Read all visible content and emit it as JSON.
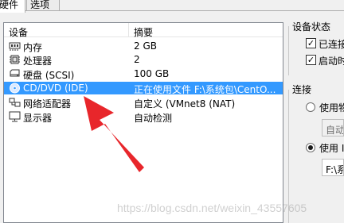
{
  "tabs": [
    {
      "label": "硬件",
      "active": true
    },
    {
      "label": "选项",
      "active": false
    }
  ],
  "device_list": {
    "columns": [
      "设备",
      "摘要"
    ],
    "rows": [
      {
        "icon": "memory-icon",
        "name": "内存",
        "summary": "2 GB",
        "selected": false
      },
      {
        "icon": "processor-icon",
        "name": "处理器",
        "summary": "2",
        "selected": false
      },
      {
        "icon": "hard-disk-icon",
        "name": "硬盘 (SCSI)",
        "summary": "100 GB",
        "selected": false
      },
      {
        "icon": "cd-dvd-icon",
        "name": "CD/DVD (IDE)",
        "summary": "正在使用文件 F:\\系统包\\CentO...",
        "selected": true
      },
      {
        "icon": "network-adapter-icon",
        "name": "网络适配器",
        "summary": "自定义 (VMnet8 (NAT)",
        "selected": false
      },
      {
        "icon": "display-icon",
        "name": "显示器",
        "summary": "自动检测",
        "selected": false
      }
    ]
  },
  "device_status": {
    "title": "设备状态",
    "connected_label": "已连接",
    "connected_checked": true,
    "connect_on_power_label": "启动时",
    "connect_on_power_checked": true
  },
  "connection": {
    "title": "连接",
    "physical_label": "使用物",
    "physical_selected": false,
    "auto_detect_value": "自动",
    "iso_label": "使用 I",
    "iso_selected": true,
    "iso_path_value": "F:\\系"
  },
  "watermark": "https://blog.csdn.net/weixin_43557605",
  "colors": {
    "selection": "#3399ff",
    "arrow": "#e8262b",
    "panel_border": "#828790",
    "window_bg": "#f0f0f0"
  }
}
